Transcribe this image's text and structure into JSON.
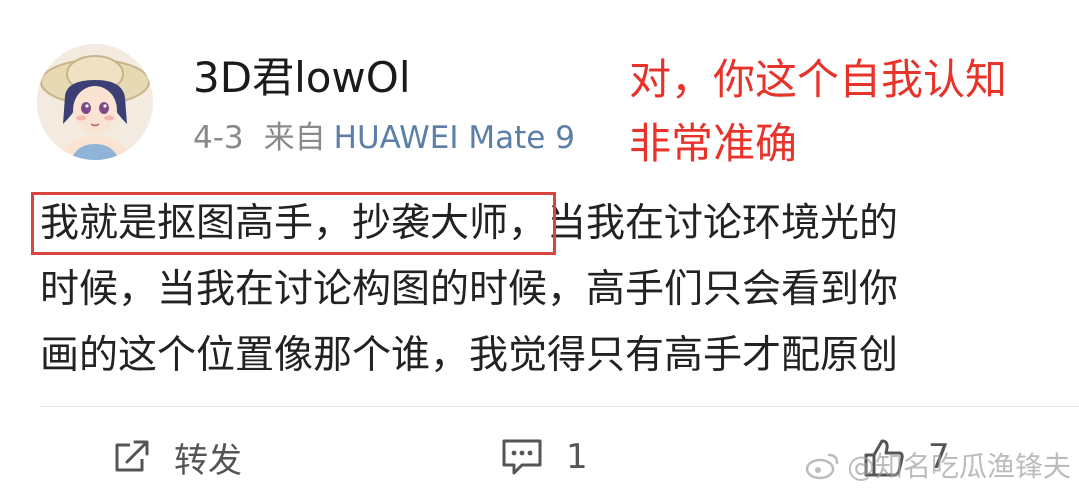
{
  "post": {
    "username": "3D君lowOl",
    "date": "4-3",
    "from_label": "来自",
    "device": "HUAWEI Mate 9",
    "body_lines": [
      {
        "highlight": "我就是抠图高手，抄袭大师，",
        "rest": "当我在讨论环境光的"
      },
      {
        "highlight": "",
        "rest": "时候，当我在讨论构图的时候，高手们只会看到你"
      },
      {
        "highlight": "",
        "rest": "画的这个位置像那个谁，我觉得只有高手才配原创"
      }
    ]
  },
  "annotation": {
    "line1": "对，你这个自我认知",
    "line2": "非常准确"
  },
  "actions": {
    "repost_label": "转发",
    "comment_count": "1",
    "like_count": "7"
  },
  "watermark": {
    "text": "@知名吃瓜渔锋夫"
  },
  "icons": [
    "avatar",
    "repost-icon",
    "comment-icon",
    "like-icon",
    "weibo-logo-icon"
  ],
  "colors": {
    "annotation": "#e8332b",
    "highlight_box": "#d8453f",
    "device_link": "#5b7fa6",
    "meta_gray": "#8a8a8a"
  }
}
